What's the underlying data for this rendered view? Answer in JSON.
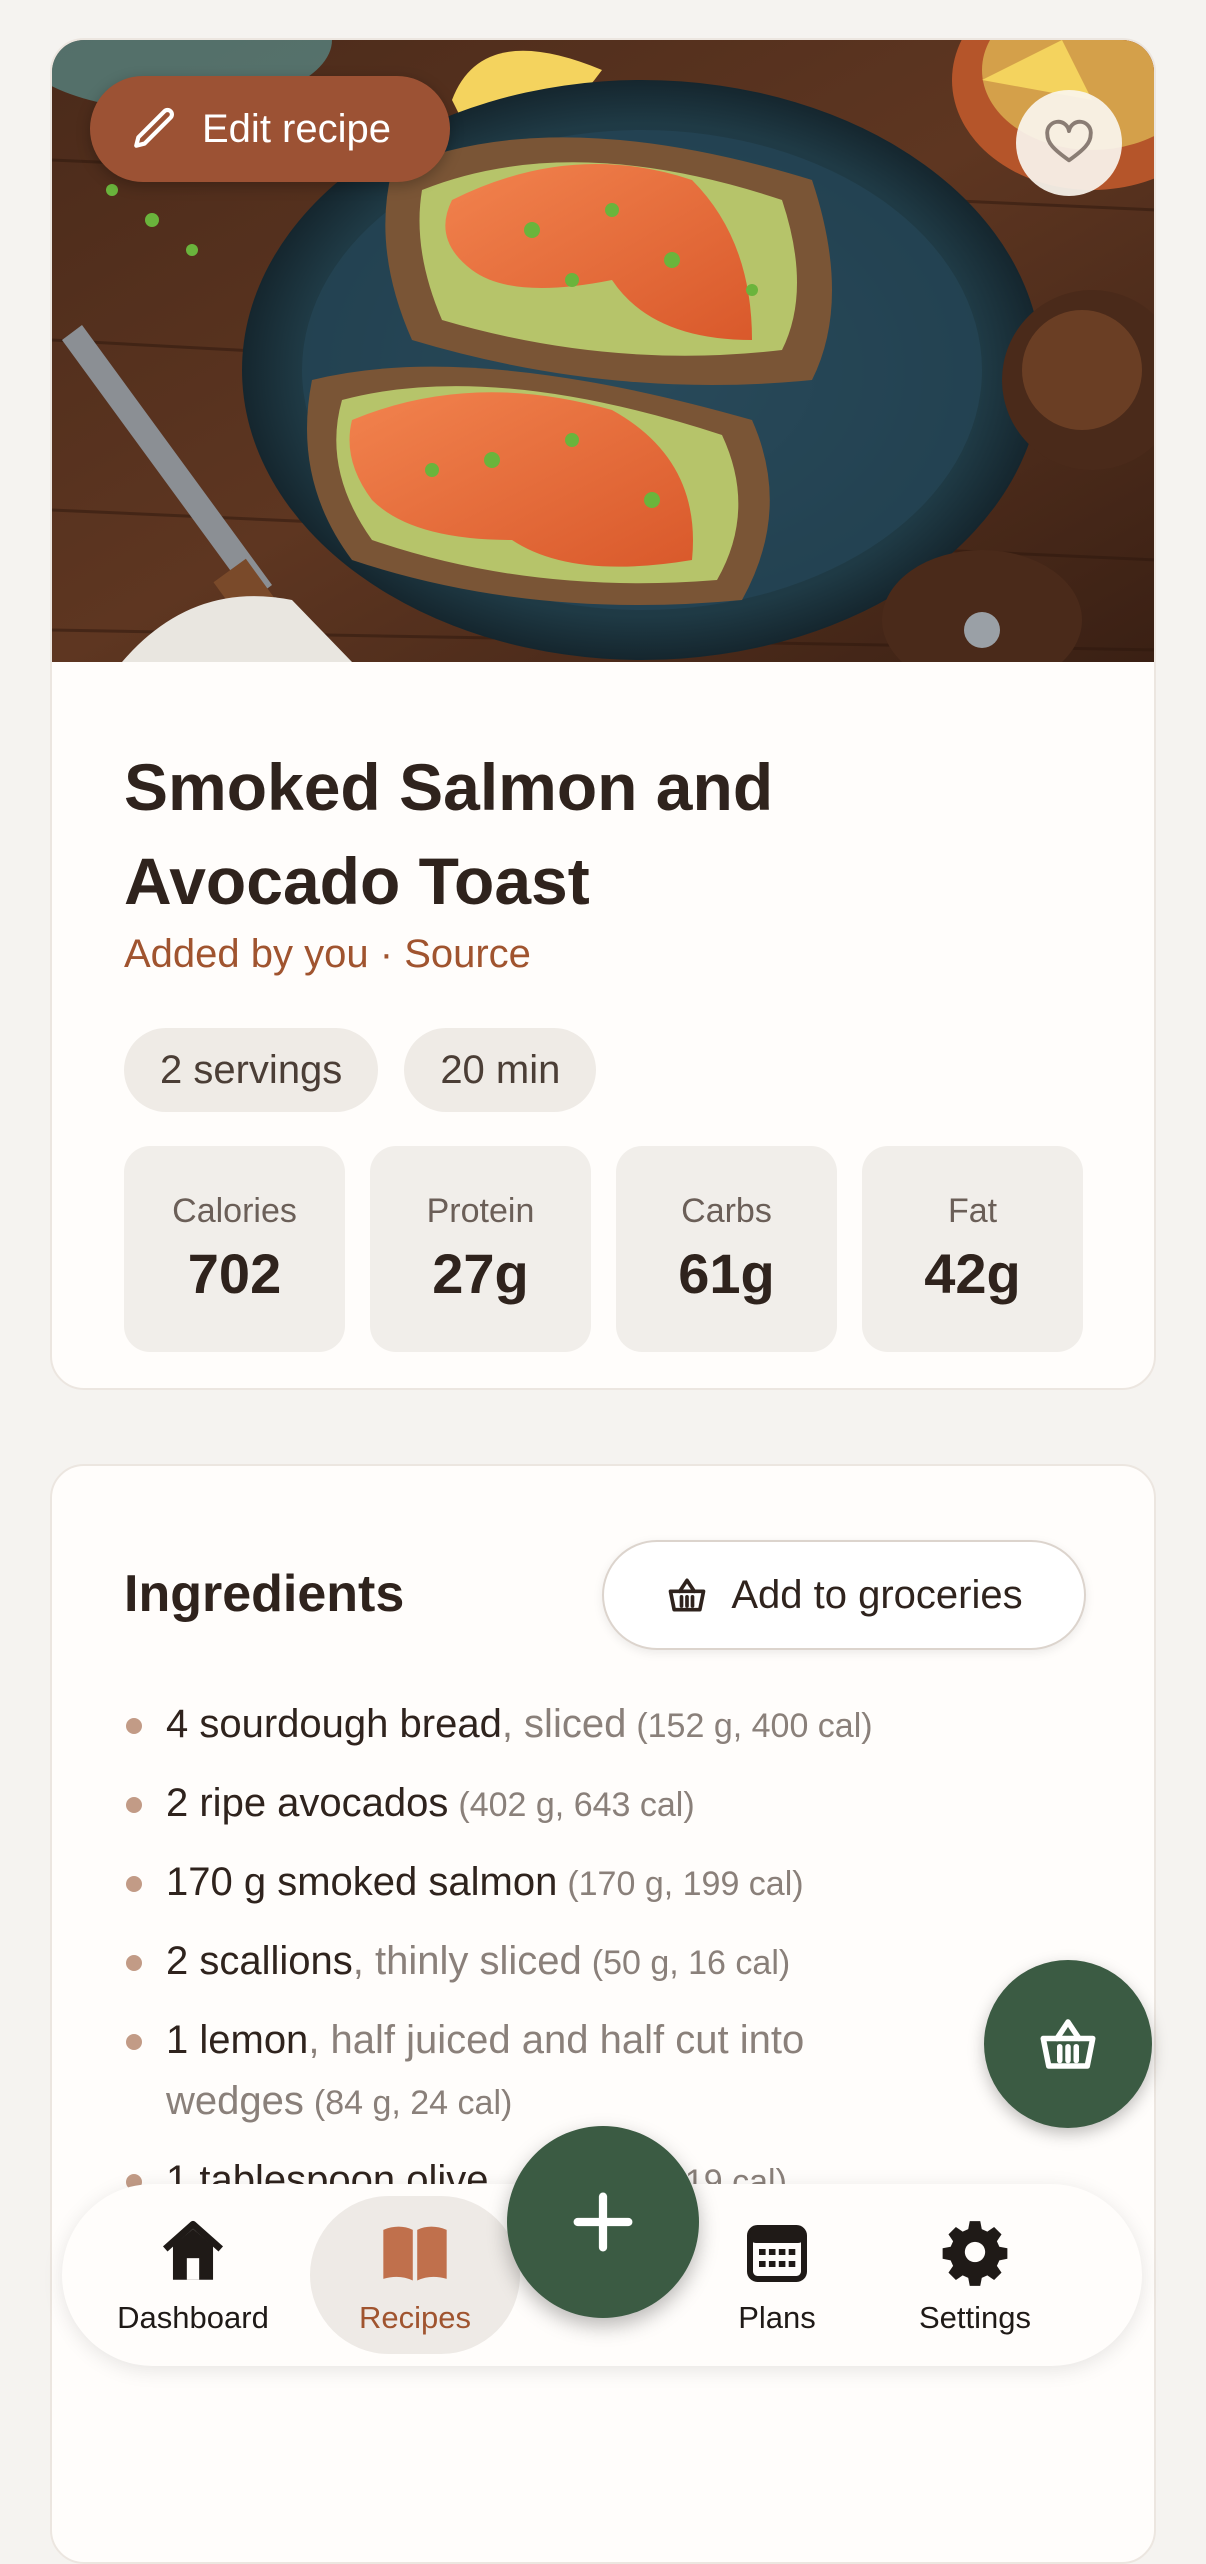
{
  "recipe": {
    "edit_label": "Edit recipe",
    "title": "Smoked Salmon and Avocado Toast",
    "added_by": "Added by you",
    "separator": " · ",
    "source_label": "Source",
    "servings": "2 servings",
    "time": "20 min",
    "macros": [
      {
        "label": "Calories",
        "value": "702"
      },
      {
        "label": "Protein",
        "value": "27g"
      },
      {
        "label": "Carbs",
        "value": "61g"
      },
      {
        "label": "Fat",
        "value": "42g"
      }
    ]
  },
  "ingredients": {
    "heading": "Ingredients",
    "add_groceries_label": "Add to groceries",
    "items": [
      {
        "main": "4 sourdough bread",
        "note": ", sliced",
        "meta": "(152 g, 400 cal)"
      },
      {
        "main": "2 ripe avocados",
        "note": "",
        "meta": "(402 g, 643 cal)"
      },
      {
        "main": "170 g smoked salmon",
        "note": "",
        "meta": "(170 g, 199 cal)"
      },
      {
        "main": "2 scallions",
        "note": ", thinly sliced",
        "meta": "(50 g, 16 cal)"
      },
      {
        "main": "1 lemon",
        "note": ", half juiced and half cut into wedges",
        "meta": "(84 g, 24 cal)"
      },
      {
        "main": "1 tablespoon olive",
        "note": "",
        "meta": "119 cal)"
      }
    ]
  },
  "nav": {
    "items": [
      {
        "label": "Dashboard",
        "icon": "home-icon"
      },
      {
        "label": "Recipes",
        "icon": "book-icon"
      },
      {
        "label": "Plans",
        "icon": "calendar-icon"
      },
      {
        "label": "Settings",
        "icon": "gear-icon"
      }
    ]
  },
  "colors": {
    "accent": "#a0542f",
    "primary_green": "#3b5b43",
    "background": "#f5f3f0"
  }
}
